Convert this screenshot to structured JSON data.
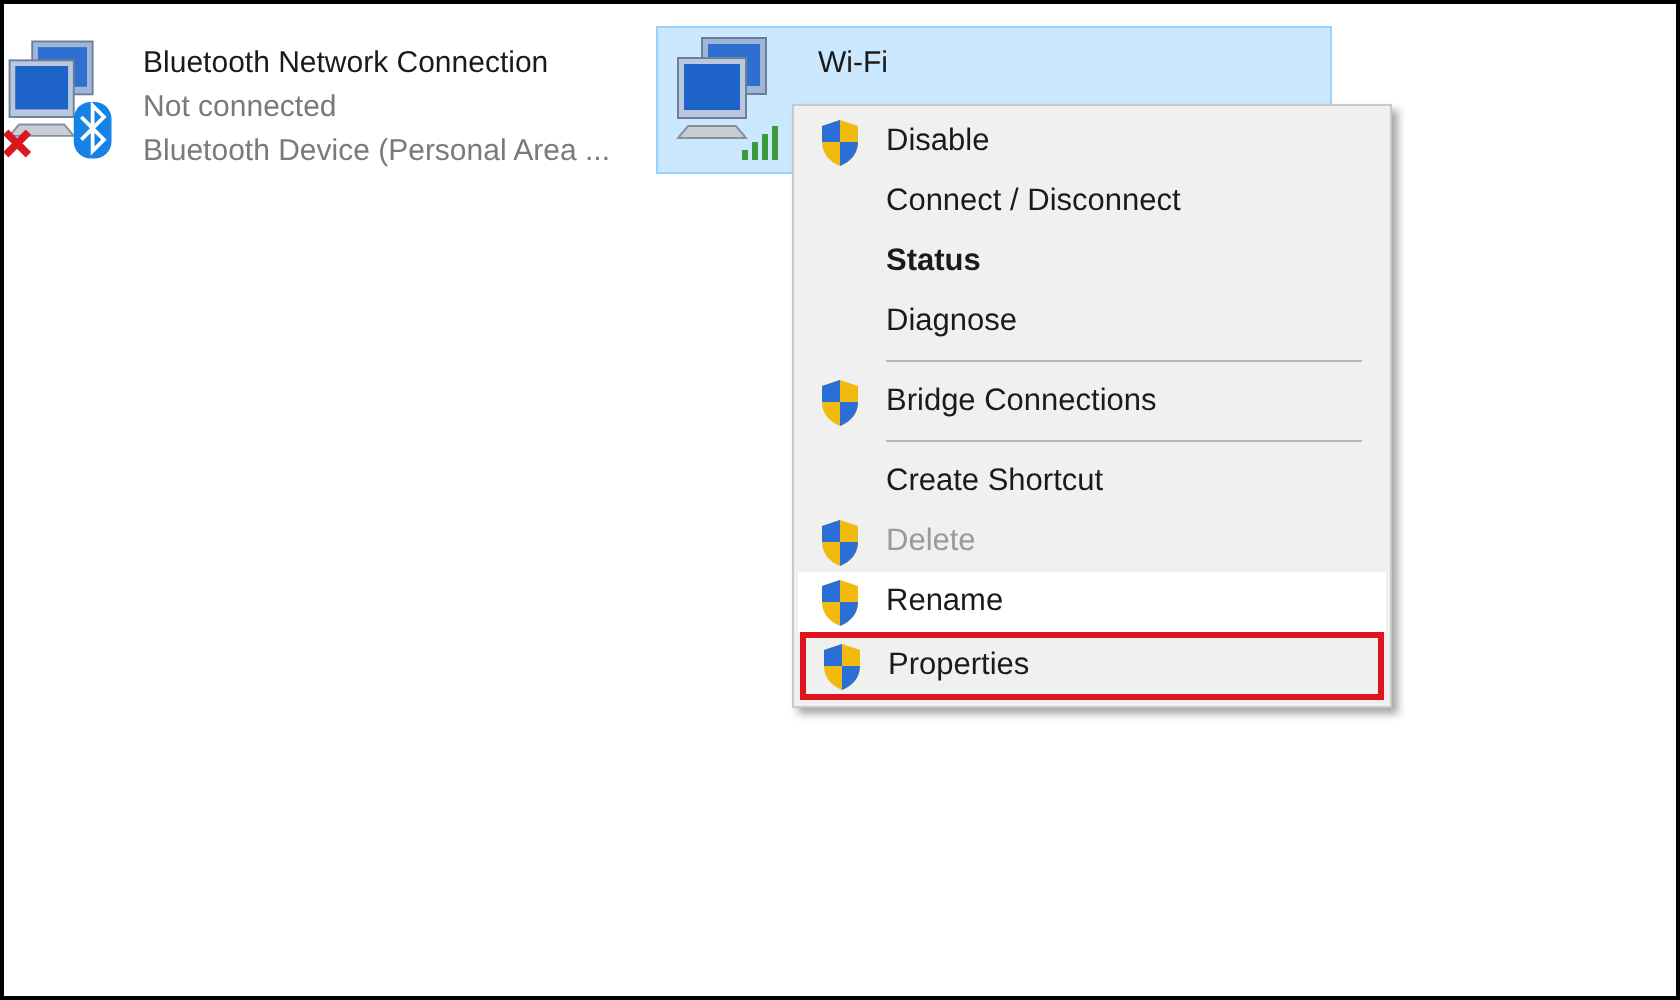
{
  "adapters": [
    {
      "name": "Bluetooth Network Connection",
      "status": "Not connected",
      "device": "Bluetooth Device (Personal Area ...",
      "selected": false,
      "kind": "bluetooth"
    },
    {
      "name": "Wi-Fi",
      "selected": true,
      "kind": "wifi"
    }
  ],
  "context_menu": {
    "items": [
      {
        "kind": "item",
        "label": "Disable",
        "shield": true,
        "default": false,
        "disabled": false,
        "hovered": false,
        "outlined": false
      },
      {
        "kind": "item",
        "label": "Connect / Disconnect",
        "shield": false,
        "default": false,
        "disabled": false,
        "hovered": false,
        "outlined": false
      },
      {
        "kind": "item",
        "label": "Status",
        "shield": false,
        "default": true,
        "disabled": false,
        "hovered": false,
        "outlined": false
      },
      {
        "kind": "item",
        "label": "Diagnose",
        "shield": false,
        "default": false,
        "disabled": false,
        "hovered": false,
        "outlined": false
      },
      {
        "kind": "separator"
      },
      {
        "kind": "item",
        "label": "Bridge Connections",
        "shield": true,
        "default": false,
        "disabled": false,
        "hovered": false,
        "outlined": false
      },
      {
        "kind": "separator"
      },
      {
        "kind": "item",
        "label": "Create Shortcut",
        "shield": false,
        "default": false,
        "disabled": false,
        "hovered": false,
        "outlined": false
      },
      {
        "kind": "item",
        "label": "Delete",
        "shield": true,
        "default": false,
        "disabled": true,
        "hovered": false,
        "outlined": false
      },
      {
        "kind": "item",
        "label": "Rename",
        "shield": true,
        "default": false,
        "disabled": false,
        "hovered": true,
        "outlined": false
      },
      {
        "kind": "item",
        "label": "Properties",
        "shield": true,
        "default": false,
        "disabled": false,
        "hovered": false,
        "outlined": true
      }
    ]
  }
}
